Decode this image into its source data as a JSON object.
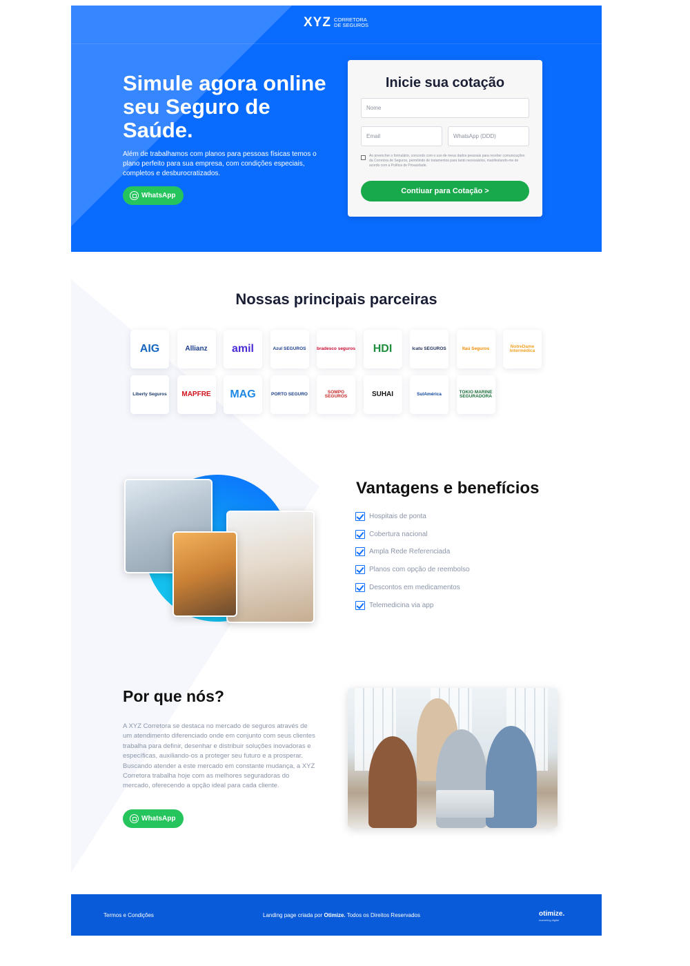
{
  "brand": {
    "mark": "XYZ",
    "sub": "CORRETORA DE SEGUROS"
  },
  "hero": {
    "title": "Simule agora online seu Seguro de Saúde.",
    "text": "Além de trabalhamos com planos para pessoas físicas temos o plano perfeito para sua empresa, com condições especiais, completos e desburocratizados.",
    "whatsapp_label": "WhatsApp"
  },
  "form": {
    "title": "Inicie sua cotação",
    "name_placeholder": "Nome",
    "email_placeholder": "Email",
    "whatsapp_placeholder": "WhatsApp (DDD)",
    "consent_text": "Ao preencher o formulário, concordo com o uso de meus dados pessoais para receber comunicações da Corretora de Seguros, permitindo de tratamentos para tanto necessários, manifestando-me de acordo com a Política de Privacidade.",
    "submit_label": "Contiuar para Cotação >"
  },
  "partners": {
    "title": "Nossas principais parceiras",
    "logos": [
      {
        "label": "AIG",
        "color": "#1565c0"
      },
      {
        "label": "Allianz",
        "color": "#1a3c8c"
      },
      {
        "label": "amil",
        "color": "#4a2bd6"
      },
      {
        "label": "Azul SEGUROS",
        "color": "#1b3d8f"
      },
      {
        "label": "bradesco seguros",
        "color": "#cc092f"
      },
      {
        "label": "HDI",
        "color": "#1e8e3e"
      },
      {
        "label": "Icatu SEGUROS",
        "color": "#1a2a55"
      },
      {
        "label": "Itaú Seguros",
        "color": "#f28c00"
      },
      {
        "label": "NotreDame Intermédica",
        "color": "#f0a020"
      },
      {
        "label": "Liberty Seguros",
        "color": "#1a3a6b"
      },
      {
        "label": "MAPFRE",
        "color": "#d2121a"
      },
      {
        "label": "MAG",
        "color": "#1e88e5"
      },
      {
        "label": "PORTO SEGURO",
        "color": "#1a3c8c"
      },
      {
        "label": "SOMPO SEGUROS",
        "color": "#c62828"
      },
      {
        "label": "SUHAI",
        "color": "#111111"
      },
      {
        "label": "SulAmérica",
        "color": "#0d47a1"
      },
      {
        "label": "TOKIO MARINE SEGURADORA",
        "color": "#1b6e3a"
      }
    ]
  },
  "benefits": {
    "title": "Vantagens e benefícios",
    "items": [
      "Hospitais de ponta",
      "Cobertura nacional",
      "Ampla Rede Referenciada",
      "Planos com opção de reembolso",
      "Descontos em medicamentos",
      "Telemedicina via app"
    ]
  },
  "why": {
    "title": "Por que nós?",
    "text": "A XYZ Corretora se destaca no mercado de seguros através de um atendimento diferenciado onde em conjunto com seus clientes trabalha para definir, desenhar e distribuir soluções inovadoras e específicas, auxiliando-os a proteger seu futuro e a prosperar. Buscando atender a este mercado em constante mudança, a XYZ Corretora trabalha hoje com as melhores seguradoras do mercado, oferecendo a opção ideal para cada cliente.",
    "whatsapp_label": "WhatsApp"
  },
  "footer": {
    "terms": "Termos e Condições",
    "credit_prefix": "Landing page criada por ",
    "credit_brand": "Otimize.",
    "credit_suffix": " Todos os Direitos Reservados",
    "brand": "otimize.",
    "brand_sub": "marketing digital"
  },
  "colors": {
    "primary": "#0a6cff",
    "green": "#17a94a",
    "whatsapp": "#25c45c",
    "footer": "#0a5bd9"
  }
}
